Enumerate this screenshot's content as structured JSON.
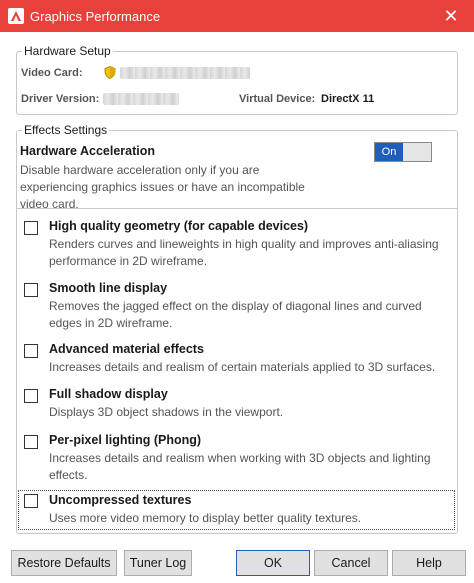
{
  "window": {
    "title": "Graphics Performance",
    "close_glyph": "✕",
    "icon": "autocad-logo-icon",
    "titlebar_color": "#e8403a"
  },
  "hardware_setup": {
    "legend": "Hardware Setup",
    "video_card_label": "Video Card:",
    "driver_version_label": "Driver Version:",
    "virtual_device_label": "Virtual Device:",
    "virtual_device_value": "DirectX 11"
  },
  "effects_settings": {
    "legend": "Effects Settings",
    "hardware_acceleration": {
      "title": "Hardware Acceleration",
      "description": "Disable hardware acceleration only if you are experiencing graphics issues or have an incompatible video card.",
      "toggle_label": "On",
      "enabled": true,
      "toggle_color": "#1f5fb8"
    },
    "options": [
      {
        "title": "High quality geometry (for capable devices)",
        "description": "Renders curves and lineweights in high quality and improves anti-aliasing performance in 2D wireframe.",
        "checked": false
      },
      {
        "title": "Smooth line display",
        "description": "Removes the jagged effect on the display of diagonal lines and curved edges in 2D wireframe.",
        "checked": false
      },
      {
        "title": "Advanced material effects",
        "description": "Increases details and realism of certain materials applied to 3D surfaces.",
        "checked": false
      },
      {
        "title": "Full shadow display",
        "description": "Displays 3D object shadows in the viewport.",
        "checked": false
      },
      {
        "title": "Per-pixel lighting (Phong)",
        "description": "Increases details and realism when working with 3D objects and lighting effects.",
        "checked": false
      },
      {
        "title": "Uncompressed textures",
        "description": "Uses more video memory to display better quality textures.",
        "checked": false
      }
    ]
  },
  "buttons": {
    "restore_defaults": "Restore Defaults",
    "tuner_log": "Tuner Log",
    "ok": "OK",
    "cancel": "Cancel",
    "help": "Help"
  }
}
